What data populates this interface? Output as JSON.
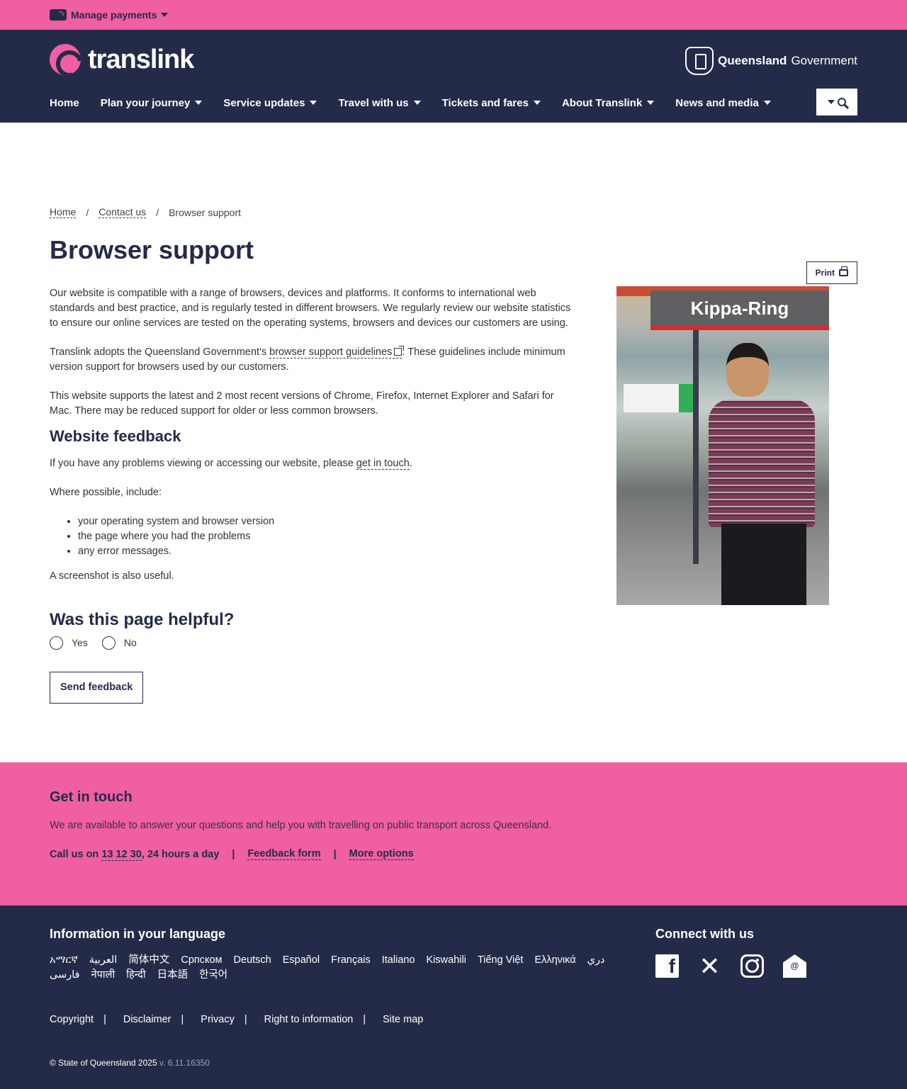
{
  "topbar": {
    "manage_payments": "Manage payments"
  },
  "header": {
    "logo_text": "translink",
    "gov_bold": "Queensland",
    "gov_rest": "Government",
    "nav": [
      "Home",
      "Plan your journey",
      "Service updates",
      "Travel with us",
      "Tickets and fares",
      "About Translink",
      "News and media"
    ]
  },
  "breadcrumb": {
    "home": "Home",
    "contact": "Contact us",
    "current": "Browser support",
    "sep": "/"
  },
  "page": {
    "title": "Browser support",
    "print_label": "Print",
    "p1": "Our website is compatible with a range of browsers, devices and platforms. It conforms to international web standards and best practice, and is regularly tested in different browsers. We regularly review our website statistics to ensure our online services are tested on the operating systems, browsers and devices our customers are using.",
    "p2_before": "Translink adopts the Queensland Government's ",
    "p2_link": "browser support guidelines",
    "p2_after": ". These guidelines include minimum version support for browsers used by our customers.",
    "p3": "This website supports the latest and 2 most recent versions of Chrome, Firefox, Internet Explorer and Safari for Mac. There may be reduced support for older or less common browsers.",
    "feedback_heading": "Website feedback",
    "p4_before": "If you have any problems viewing or accessing our website, please ",
    "p4_link": "get in touch",
    "p4_after": ".",
    "p5": "Where possible, include:",
    "list": [
      "your operating system and browser version",
      "the page where you had the problems",
      "any error messages."
    ],
    "p6": "A screenshot is also useful.",
    "photo_sign": "Kippa-Ring"
  },
  "helpful": {
    "heading": "Was this page helpful?",
    "yes": "Yes",
    "no": "No",
    "send": "Send feedback"
  },
  "touch": {
    "heading": "Get in touch",
    "text": "We are available to answer your questions and help you with travelling on public transport across Queensland.",
    "call_prefix": "Call us on ",
    "phone": "13 12 30",
    "call_suffix": ", 24 hours a day",
    "feedback": "Feedback form",
    "more": "More options",
    "sep": "|"
  },
  "footer": {
    "lang_heading": "Information in your language",
    "languages": [
      "አማርኛ",
      "العربية",
      "简体中文",
      "Српском",
      "Deutsch",
      "Español",
      "Français",
      "Italiano",
      "Kiswahili",
      "Tiếng Việt",
      "Ελληνικά",
      "دري",
      "فارسی",
      "नेपाली",
      "हिन्दी",
      "日本語",
      "한국어"
    ],
    "connect_heading": "Connect with us",
    "socials": [
      "facebook-icon",
      "x-icon",
      "instagram-icon",
      "email-icon"
    ],
    "legal": [
      "Copyright",
      "Disclaimer",
      "Privacy",
      "Right to information",
      "Site map"
    ],
    "copyright": "© State of Queensland 2025",
    "version": "v. 6.11.16350"
  },
  "colors": {
    "pink": "#ef5fa2",
    "navy": "#242b48"
  }
}
